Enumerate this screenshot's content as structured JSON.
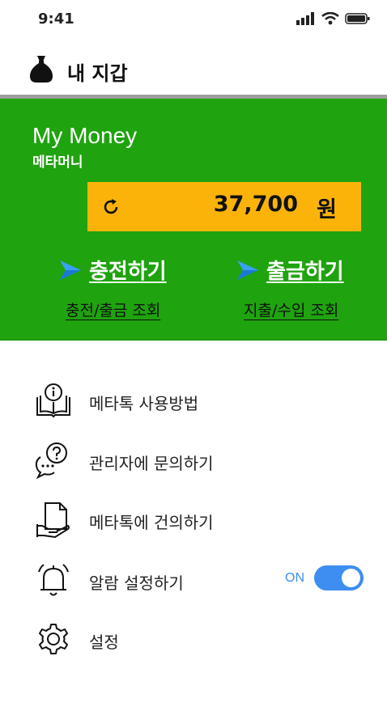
{
  "status_bar": {
    "time": "9:41",
    "icons": [
      "signal-icon",
      "wifi-icon",
      "battery-icon"
    ]
  },
  "header": {
    "title": "내 지갑",
    "icon": "money-bag-icon"
  },
  "card": {
    "title": "My Money",
    "subtitle": "메타머니",
    "balance": "37,700",
    "currency": "원",
    "refresh_icon": "refresh-icon",
    "charge_label": "충전하기",
    "withdraw_label": "출금하기",
    "charge_history_label": "충전/출금 조회",
    "spend_history_label": "지출/수입 조회",
    "action_icon": "send-arrow-icon"
  },
  "menu": {
    "items": [
      {
        "label": "메타톡 사용방법",
        "icon": "info-book-icon"
      },
      {
        "label": "관리자에 문의하기",
        "icon": "question-chat-icon"
      },
      {
        "label": "메타톡에 건의하기",
        "icon": "document-hand-icon"
      },
      {
        "label": "알람 설정하기",
        "icon": "bell-icon"
      },
      {
        "label": "설정",
        "icon": "gear-icon"
      }
    ],
    "alarm_toggle_text": "ON",
    "alarm_enabled": true
  },
  "colors": {
    "card_green": "#1fa30e",
    "balance_yellow": "#fbb30a",
    "toggle_blue": "#3d8ef0",
    "arrow_blue": "#3aa0f5"
  }
}
